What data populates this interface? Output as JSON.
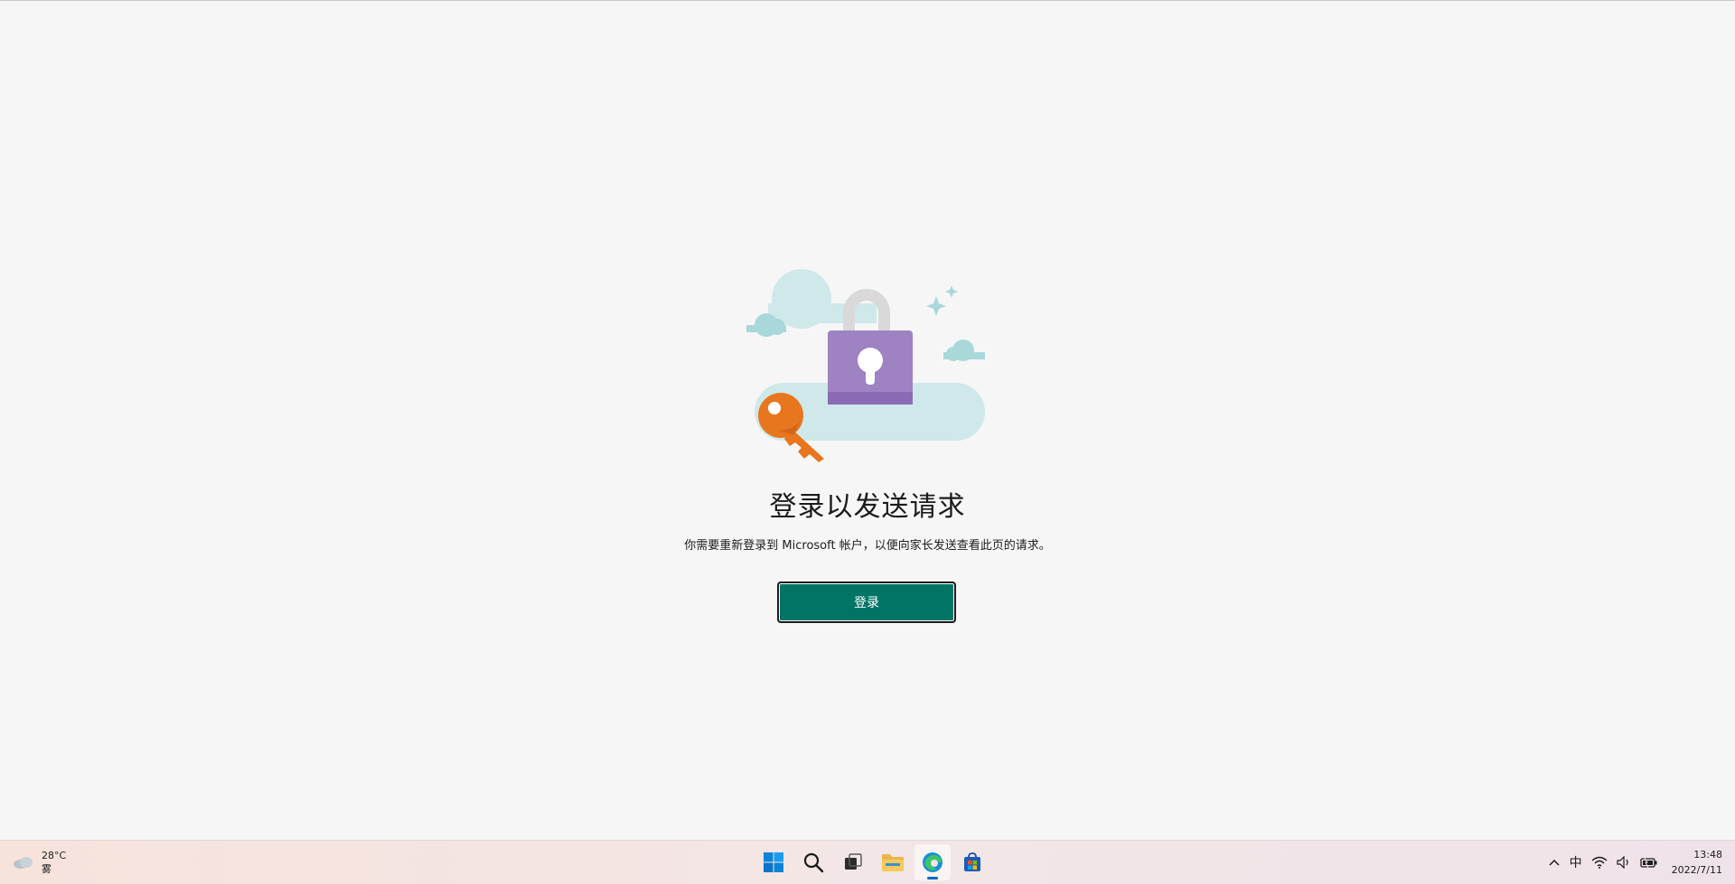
{
  "page": {
    "title": "登录以发送请求",
    "message": "你需要重新登录到 Microsoft 帐户，以便向家长发送查看此页的请求。",
    "signin_button": "登录"
  },
  "illustration": {
    "name": "lock-and-key",
    "colors": {
      "cloud": "#cfe8ea",
      "lock_body": "#9e82c2",
      "lock_bottom": "#8a6bb5",
      "shackle": "#d9d9d9",
      "key": "#e8761e"
    }
  },
  "taskbar": {
    "weather": {
      "temperature": "28°C",
      "condition": "雾",
      "icon": "cloud-icon"
    },
    "apps": [
      {
        "name": "start",
        "icon": "windows-logo-icon"
      },
      {
        "name": "search",
        "icon": "search-icon"
      },
      {
        "name": "task-view",
        "icon": "task-view-icon"
      },
      {
        "name": "file-explorer",
        "icon": "folder-icon"
      },
      {
        "name": "edge",
        "icon": "edge-icon",
        "active": true
      },
      {
        "name": "store",
        "icon": "store-icon"
      }
    ],
    "tray": {
      "overflow": "^",
      "ime": "中",
      "icons": [
        "wifi-icon",
        "volume-icon",
        "battery-icon"
      ]
    },
    "clock": {
      "time": "13:48",
      "date": "2022/7/11"
    }
  },
  "colors": {
    "accent_button": "#007565",
    "background": "#f6f6f6",
    "edge_indicator": "#0067c0"
  }
}
